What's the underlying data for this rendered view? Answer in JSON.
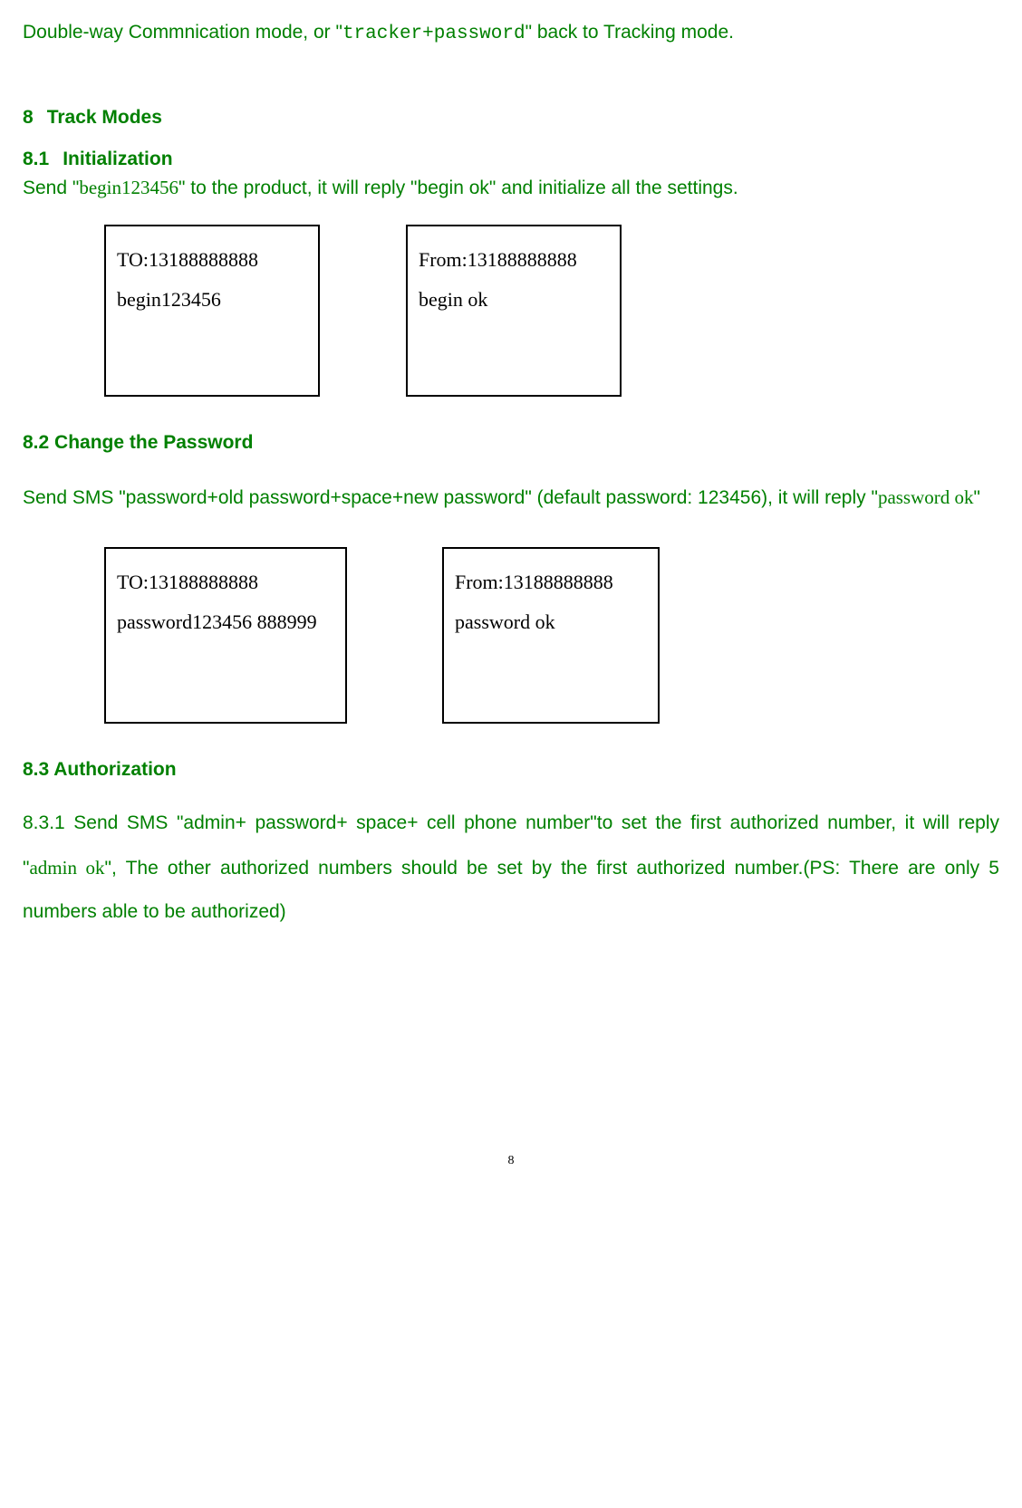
{
  "intro": {
    "prefix": "Double-way Commnication mode, or \"",
    "code": "tracker+password",
    "suffix": "\" back to Tracking mode."
  },
  "section8": {
    "num": "8",
    "title": "Track Modes"
  },
  "s81": {
    "num": "8.1",
    "title": "Initialization",
    "p1_a": "Send \"",
    "p1_code": "begin123456",
    "p1_b": "\"    to the product, it will reply \"begin ok\" and initialize all the settings.",
    "box1_line1": "TO:13188888888",
    "box1_line2": "begin123456",
    "box2_line1": "From:13188888888",
    "box2_line2": "begin ok"
  },
  "s82": {
    "heading": "8.2 Change the Password",
    "p1_a": "Send SMS \"password+old password+space+new password\" (default password: 123456), it will reply \"",
    "p1_code": "password ok",
    "p1_b": "\"",
    "box1_line1": "TO:13188888888",
    "box1_line2": "password123456 888999",
    "box2_line1": "From:13188888888",
    "box2_line2": "password ok"
  },
  "s83": {
    "heading": "8.3 Authorization",
    "p1_a": "8.3.1 Send SMS \"admin+ password+ space+ cell phone number\"to set  the first authorized number, it will reply \"",
    "p1_code": "admin ok",
    "p1_b": "\", The other authorized numbers should be set by the first authorized number.(PS: There are only 5 numbers able to be authorized)"
  },
  "page_number": "8"
}
